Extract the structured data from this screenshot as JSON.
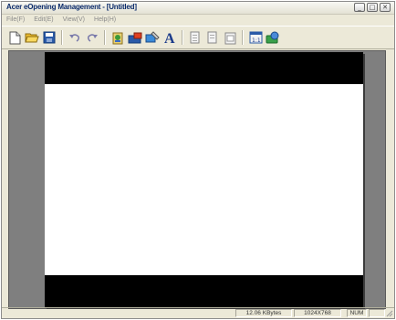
{
  "window": {
    "title": "Acer eOpening Management - [Untitled]",
    "caption_buttons": {
      "minimize": "_",
      "maximize": "□",
      "close": "✕"
    }
  },
  "menu": [
    {
      "label": "File(F)"
    },
    {
      "label": "Edit(E)"
    },
    {
      "label": "View(V)"
    },
    {
      "label": "Help(H)"
    }
  ],
  "toolbar": {
    "buttons": [
      "new-file-icon",
      "open-folder-icon",
      "save-icon",
      "undo-icon",
      "redo-icon",
      "insert-image-icon",
      "open-media-icon",
      "edit-image-icon",
      "text-icon",
      "cut-icon",
      "copy-icon",
      "paste-icon",
      "zoom-1to1-icon",
      "preview-icon"
    ],
    "text_tool_glyph": "A",
    "zoom_label": "1:1"
  },
  "status": {
    "size": "12.06 KBytes",
    "resolution": "1024X768",
    "numlock": "NUM"
  },
  "colors": {
    "workspace": "#7f7f7f",
    "band": "#000000",
    "canvas": "#ffffff"
  }
}
